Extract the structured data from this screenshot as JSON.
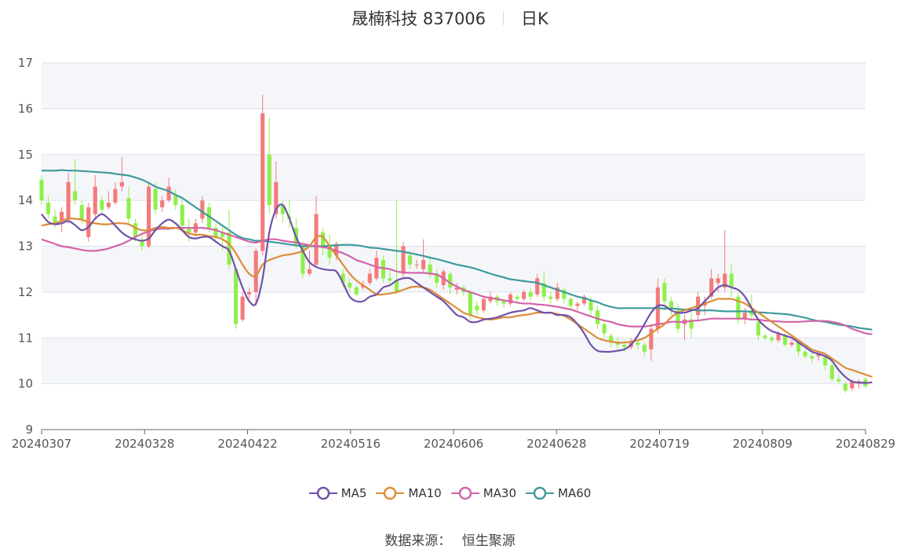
{
  "header": {
    "title": "晟楠科技 837006",
    "period": "日K"
  },
  "footer": {
    "source_label": "数据来源：",
    "source_name": "恒生聚源"
  },
  "colors": {
    "up": "#f47b7b",
    "down": "#8ef04a",
    "plot_band": "#f5f6fa",
    "grid": "#dde1ec",
    "MA5": "#7152a8",
    "MA10": "#dd8c38",
    "MA30": "#d264a8",
    "MA60": "#3f9a9c"
  },
  "chart_data": {
    "type": "candlestick",
    "title": "晟楠科技 837006",
    "ylim": [
      9,
      17
    ],
    "yticks": [
      "9",
      "10",
      "11",
      "12",
      "13",
      "14",
      "15",
      "16",
      "17"
    ],
    "xtick_labels": [
      "20240307",
      "20240328",
      "20240422",
      "20240516",
      "20240606",
      "20240628",
      "20240719",
      "20240809",
      "20240829"
    ],
    "legend_position": "bottom",
    "candles": [
      [
        14.45,
        14.0,
        14.55,
        13.9
      ],
      [
        13.95,
        13.7,
        14.1,
        13.6
      ],
      [
        13.65,
        13.5,
        13.8,
        13.4
      ],
      [
        13.55,
        13.75,
        13.85,
        13.3
      ],
      [
        13.6,
        14.4,
        14.6,
        13.5
      ],
      [
        14.2,
        14.0,
        14.9,
        13.9
      ],
      [
        13.9,
        13.6,
        14.0,
        13.5
      ],
      [
        13.2,
        13.85,
        13.95,
        13.1
      ],
      [
        13.7,
        14.3,
        14.55,
        13.6
      ],
      [
        14.0,
        13.8,
        14.1,
        13.7
      ],
      [
        13.85,
        13.95,
        14.2,
        13.8
      ],
      [
        13.95,
        14.25,
        14.4,
        13.9
      ],
      [
        14.3,
        14.4,
        14.95,
        14.2
      ],
      [
        14.05,
        13.6,
        14.3,
        13.5
      ],
      [
        13.5,
        13.2,
        13.6,
        13.1
      ],
      [
        13.1,
        13.0,
        13.3,
        12.9
      ],
      [
        13.0,
        14.3,
        14.4,
        12.95
      ],
      [
        14.25,
        13.8,
        14.4,
        13.7
      ],
      [
        13.85,
        14.0,
        14.1,
        13.75
      ],
      [
        14.0,
        14.3,
        14.5,
        13.95
      ],
      [
        14.1,
        13.9,
        14.25,
        13.8
      ],
      [
        13.9,
        13.45,
        14.0,
        13.3
      ],
      [
        13.4,
        13.3,
        13.6,
        13.1
      ],
      [
        13.3,
        13.5,
        13.6,
        13.2
      ],
      [
        13.6,
        14.0,
        14.1,
        13.5
      ],
      [
        13.85,
        13.4,
        13.95,
        13.3
      ],
      [
        13.4,
        13.2,
        13.5,
        13.1
      ],
      [
        13.3,
        13.2,
        13.4,
        12.9
      ],
      [
        13.3,
        12.6,
        13.8,
        12.5
      ],
      [
        12.5,
        11.3,
        12.55,
        11.2
      ],
      [
        11.4,
        11.9,
        12.0,
        11.35
      ],
      [
        11.95,
        12.0,
        12.1,
        11.85
      ],
      [
        12.0,
        12.9,
        12.95,
        11.7
      ],
      [
        12.9,
        15.9,
        16.3,
        12.8
      ],
      [
        15.0,
        13.9,
        15.8,
        13.7
      ],
      [
        13.7,
        14.4,
        14.85,
        13.6
      ],
      [
        13.9,
        13.7,
        14.0,
        13.5
      ],
      [
        13.65,
        13.6,
        14.0,
        13.4
      ],
      [
        13.4,
        13.05,
        13.6,
        12.95
      ],
      [
        13.0,
        12.4,
        13.1,
        12.3
      ],
      [
        12.4,
        12.5,
        12.9,
        12.35
      ],
      [
        12.6,
        13.7,
        14.1,
        12.55
      ],
      [
        13.3,
        13.0,
        13.4,
        12.8
      ],
      [
        13.0,
        12.75,
        13.25,
        12.6
      ],
      [
        12.8,
        13.05,
        13.1,
        12.7
      ],
      [
        12.4,
        12.2,
        12.5,
        12.1
      ],
      [
        12.2,
        12.1,
        12.3,
        12.0
      ],
      [
        12.1,
        11.95,
        12.15,
        11.9
      ],
      [
        12.1,
        12.15,
        12.25,
        12.05
      ],
      [
        12.2,
        12.4,
        12.5,
        12.15
      ],
      [
        12.3,
        12.75,
        12.9,
        12.25
      ],
      [
        12.7,
        12.3,
        12.8,
        12.2
      ],
      [
        12.3,
        12.25,
        12.5,
        12.2
      ],
      [
        12.25,
        12.0,
        14.0,
        11.95
      ],
      [
        12.4,
        13.0,
        13.1,
        12.3
      ],
      [
        12.8,
        12.6,
        12.9,
        12.5
      ],
      [
        12.6,
        12.6,
        12.7,
        12.5
      ],
      [
        12.5,
        12.7,
        13.15,
        12.45
      ],
      [
        12.6,
        12.4,
        12.8,
        12.3
      ],
      [
        12.4,
        12.2,
        12.5,
        12.1
      ],
      [
        12.15,
        12.45,
        12.5,
        12.05
      ],
      [
        12.4,
        12.1,
        12.45,
        11.95
      ],
      [
        12.05,
        12.1,
        12.2,
        11.95
      ],
      [
        12.1,
        12.0,
        12.15,
        11.9
      ],
      [
        12.0,
        11.5,
        12.05,
        11.4
      ],
      [
        11.7,
        11.6,
        11.8,
        11.5
      ],
      [
        11.6,
        11.85,
        11.9,
        11.55
      ],
      [
        11.8,
        11.9,
        12.0,
        11.75
      ],
      [
        11.9,
        11.8,
        11.95,
        11.7
      ],
      [
        11.8,
        11.75,
        11.85,
        11.65
      ],
      [
        11.75,
        11.95,
        12.0,
        11.7
      ],
      [
        11.9,
        11.85,
        11.95,
        11.8
      ],
      [
        11.85,
        12.0,
        12.05,
        11.8
      ],
      [
        12.0,
        11.9,
        12.1,
        11.8
      ],
      [
        11.95,
        12.3,
        12.4,
        11.9
      ],
      [
        12.2,
        11.9,
        12.45,
        11.8
      ],
      [
        11.9,
        11.85,
        12.0,
        11.75
      ],
      [
        11.85,
        12.1,
        12.2,
        11.8
      ],
      [
        12.05,
        11.85,
        12.1,
        11.75
      ],
      [
        11.85,
        11.7,
        11.9,
        11.6
      ],
      [
        11.7,
        11.75,
        11.8,
        11.6
      ],
      [
        11.75,
        11.9,
        11.95,
        11.7
      ],
      [
        11.8,
        11.6,
        11.9,
        11.5
      ],
      [
        11.6,
        11.3,
        11.7,
        11.2
      ],
      [
        11.3,
        11.1,
        11.4,
        11.0
      ],
      [
        11.05,
        10.9,
        11.1,
        10.8
      ],
      [
        10.9,
        10.85,
        11.0,
        10.75
      ],
      [
        10.85,
        10.8,
        10.95,
        10.7
      ],
      [
        10.8,
        10.9,
        11.0,
        10.75
      ],
      [
        10.9,
        10.85,
        10.95,
        10.75
      ],
      [
        10.85,
        10.7,
        10.9,
        10.6
      ],
      [
        10.75,
        11.2,
        11.3,
        10.5
      ],
      [
        11.2,
        12.1,
        12.3,
        11.1
      ],
      [
        12.2,
        11.8,
        12.3,
        11.6
      ],
      [
        11.8,
        11.65,
        11.9,
        11.5
      ],
      [
        11.6,
        11.2,
        11.75,
        11.1
      ],
      [
        11.3,
        11.4,
        11.5,
        10.95
      ],
      [
        11.4,
        11.2,
        11.6,
        11.0
      ],
      [
        11.5,
        11.9,
        12.0,
        11.4
      ],
      [
        11.7,
        11.8,
        11.9,
        11.5
      ],
      [
        11.9,
        12.3,
        12.5,
        11.85
      ],
      [
        12.2,
        12.3,
        12.4,
        12.0
      ],
      [
        12.1,
        12.4,
        13.35,
        12.0
      ],
      [
        12.4,
        12.1,
        12.6,
        11.9
      ],
      [
        11.9,
        11.4,
        12.0,
        11.3
      ],
      [
        11.4,
        11.55,
        11.65,
        11.3
      ],
      [
        11.6,
        11.5,
        11.95,
        11.4
      ],
      [
        11.35,
        11.05,
        11.4,
        10.95
      ],
      [
        11.05,
        11.0,
        11.1,
        10.95
      ],
      [
        11.0,
        10.95,
        11.05,
        10.9
      ],
      [
        10.95,
        11.1,
        11.15,
        10.9
      ],
      [
        11.05,
        10.85,
        11.1,
        10.8
      ],
      [
        10.85,
        10.9,
        10.95,
        10.8
      ],
      [
        10.9,
        10.7,
        10.95,
        10.6
      ],
      [
        10.7,
        10.6,
        10.75,
        10.55
      ],
      [
        10.6,
        10.55,
        10.7,
        10.45
      ],
      [
        10.6,
        10.65,
        10.7,
        10.5
      ],
      [
        10.6,
        10.4,
        10.65,
        10.3
      ],
      [
        10.4,
        10.1,
        10.45,
        10.05
      ],
      [
        10.1,
        10.05,
        10.2,
        10.0
      ],
      [
        10.0,
        9.85,
        10.05,
        9.8
      ],
      [
        9.9,
        10.05,
        10.1,
        9.85
      ],
      [
        10.0,
        10.05,
        10.1,
        9.9
      ],
      [
        10.1,
        9.95,
        10.15,
        9.9
      ]
    ],
    "series": [
      {
        "name": "MA5",
        "values": [
          13.7,
          13.53,
          13.48,
          13.5,
          13.55,
          13.46,
          13.35,
          13.42,
          13.6,
          13.7,
          13.6,
          13.45,
          13.3,
          13.2,
          13.15,
          13.12,
          13.17,
          13.35,
          13.5,
          13.58,
          13.5,
          13.35,
          13.2,
          13.17,
          13.2,
          13.2,
          13.1,
          13.0,
          12.9,
          12.5,
          12.1,
          11.8,
          11.75,
          12.3,
          13.3,
          13.8,
          13.9,
          13.6,
          13.2,
          12.9,
          12.65,
          12.55,
          12.5,
          12.48,
          12.45,
          12.2,
          11.9,
          11.8,
          11.8,
          11.9,
          11.95,
          12.1,
          12.15,
          12.25,
          12.3,
          12.3,
          12.2,
          12.1,
          12.0,
          11.9,
          11.8,
          11.65,
          11.5,
          11.45,
          11.35,
          11.35,
          11.4,
          11.42,
          11.45,
          11.5,
          11.55,
          11.58,
          11.6,
          11.65,
          11.6,
          11.55,
          11.55,
          11.5,
          11.5,
          11.45,
          11.3,
          11.1,
          10.85,
          10.72,
          10.7,
          10.7,
          10.72,
          10.75,
          10.85,
          11.05,
          11.3,
          11.55,
          11.7,
          11.7,
          11.6,
          11.55,
          11.55,
          11.6,
          11.65,
          11.8,
          11.95,
          12.1,
          12.15,
          12.1,
          12.05,
          11.9,
          11.65,
          11.4,
          11.25,
          11.15,
          11.1,
          11.05,
          11.0,
          10.9,
          10.8,
          10.7,
          10.65,
          10.6,
          10.5,
          10.3,
          10.15,
          10.05,
          10.03,
          10.02,
          10.03
        ]
      },
      {
        "name": "MA10",
        "values": [
          13.45,
          13.48,
          13.5,
          13.55,
          13.6,
          13.6,
          13.58,
          13.52,
          13.5,
          13.48,
          13.48,
          13.5,
          13.5,
          13.48,
          13.4,
          13.35,
          13.35,
          13.4,
          13.42,
          13.4,
          13.4,
          13.35,
          13.28,
          13.25,
          13.25,
          13.22,
          13.2,
          13.15,
          13.05,
          12.85,
          12.6,
          12.4,
          12.35,
          12.6,
          12.7,
          12.75,
          12.8,
          12.82,
          12.85,
          12.9,
          13.0,
          13.2,
          13.2,
          13.0,
          12.8,
          12.6,
          12.4,
          12.25,
          12.15,
          12.05,
          11.95,
          11.95,
          11.97,
          12.0,
          12.05,
          12.1,
          12.12,
          12.1,
          12.05,
          11.95,
          11.85,
          11.75,
          11.65,
          11.55,
          11.5,
          11.45,
          11.42,
          11.4,
          11.42,
          11.45,
          11.45,
          11.48,
          11.5,
          11.52,
          11.55,
          11.55,
          11.55,
          11.52,
          11.48,
          11.4,
          11.3,
          11.2,
          11.1,
          11.0,
          10.95,
          10.92,
          10.9,
          10.9,
          10.92,
          10.95,
          11.0,
          11.1,
          11.2,
          11.3,
          11.45,
          11.55,
          11.6,
          11.65,
          11.7,
          11.75,
          11.8,
          11.85,
          11.85,
          11.85,
          11.8,
          11.75,
          11.65,
          11.55,
          11.45,
          11.35,
          11.25,
          11.15,
          11.05,
          10.95,
          10.85,
          10.75,
          10.7,
          10.65,
          10.55,
          10.45,
          10.35,
          10.3,
          10.25,
          10.2,
          10.15
        ]
      },
      {
        "name": "MA30",
        "values": [
          13.15,
          13.1,
          13.05,
          13.0,
          12.98,
          12.95,
          12.92,
          12.9,
          12.9,
          12.92,
          12.95,
          13.0,
          13.05,
          13.12,
          13.2,
          13.27,
          13.32,
          13.37,
          13.38,
          13.38,
          13.4,
          13.4,
          13.4,
          13.4,
          13.4,
          13.38,
          13.35,
          13.3,
          13.25,
          13.2,
          13.15,
          13.1,
          13.08,
          13.12,
          13.15,
          13.15,
          13.12,
          13.1,
          13.08,
          13.05,
          13.02,
          13.0,
          12.98,
          12.95,
          12.9,
          12.85,
          12.78,
          12.7,
          12.65,
          12.6,
          12.55,
          12.52,
          12.5,
          12.45,
          12.43,
          12.42,
          12.42,
          12.42,
          12.4,
          12.38,
          12.3,
          12.2,
          12.12,
          12.05,
          12.0,
          11.95,
          11.9,
          11.87,
          11.85,
          11.82,
          11.8,
          11.77,
          11.75,
          11.75,
          11.73,
          11.72,
          11.7,
          11.68,
          11.65,
          11.62,
          11.57,
          11.52,
          11.47,
          11.42,
          11.38,
          11.35,
          11.3,
          11.27,
          11.25,
          11.25,
          11.25,
          11.27,
          11.3,
          11.32,
          11.35,
          11.35,
          11.35,
          11.37,
          11.38,
          11.4,
          11.42,
          11.42,
          11.42,
          11.42,
          11.42,
          11.42,
          11.4,
          11.4,
          11.38,
          11.37,
          11.36,
          11.35,
          11.35,
          11.35,
          11.36,
          11.37,
          11.37,
          11.37,
          11.35,
          11.32,
          11.27,
          11.2,
          11.15,
          11.1,
          11.08
        ]
      },
      {
        "name": "MA60",
        "values": [
          14.65,
          14.65,
          14.65,
          14.66,
          14.65,
          14.65,
          14.64,
          14.63,
          14.62,
          14.61,
          14.6,
          14.58,
          14.56,
          14.54,
          14.5,
          14.45,
          14.38,
          14.3,
          14.25,
          14.2,
          14.12,
          14.05,
          13.95,
          13.85,
          13.75,
          13.65,
          13.55,
          13.45,
          13.35,
          13.25,
          13.18,
          13.15,
          13.12,
          13.12,
          13.1,
          13.08,
          13.06,
          13.04,
          13.02,
          13.0,
          13.0,
          13.0,
          13.0,
          13.01,
          13.02,
          13.03,
          13.03,
          13.02,
          13.0,
          12.97,
          12.96,
          12.94,
          12.92,
          12.9,
          12.88,
          12.85,
          12.82,
          12.79,
          12.75,
          12.72,
          12.68,
          12.64,
          12.6,
          12.57,
          12.54,
          12.5,
          12.45,
          12.4,
          12.36,
          12.32,
          12.28,
          12.26,
          12.24,
          12.22,
          12.2,
          12.15,
          12.1,
          12.05,
          12.0,
          11.95,
          11.9,
          11.87,
          11.82,
          11.78,
          11.72,
          11.68,
          11.65,
          11.65,
          11.65,
          11.65,
          11.65,
          11.65,
          11.65,
          11.64,
          11.64,
          11.63,
          11.62,
          11.61,
          11.6,
          11.6,
          11.6,
          11.59,
          11.58,
          11.58,
          11.58,
          11.58,
          11.57,
          11.56,
          11.55,
          11.54,
          11.53,
          11.52,
          11.5,
          11.47,
          11.44,
          11.4,
          11.37,
          11.35,
          11.32,
          11.29,
          11.27,
          11.25,
          11.22,
          11.2,
          11.18
        ]
      }
    ]
  }
}
